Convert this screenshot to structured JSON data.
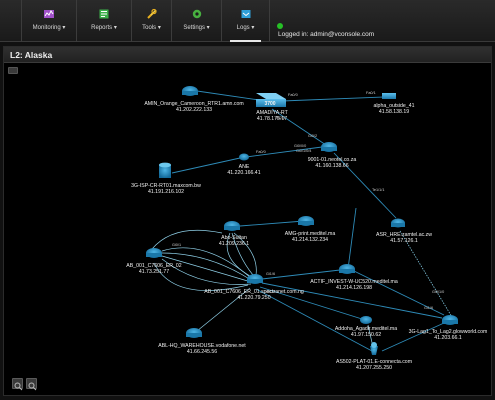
{
  "nav": {
    "items": [
      {
        "label": "Monitoring",
        "icon": "monitoring-icon"
      },
      {
        "label": "Reports",
        "icon": "reports-icon"
      },
      {
        "label": "Tools",
        "icon": "tools-icon"
      },
      {
        "label": "Settings",
        "icon": "settings-icon"
      },
      {
        "label": "Logs",
        "icon": "logs-icon"
      }
    ],
    "login_text": "Logged in: admin@vconsole.com"
  },
  "panel": {
    "title": "L2: Alaska"
  },
  "map": {
    "nodes": {
      "amin_orange": {
        "name": "AMIN_Orange_Cameroon_RTR1.amn.com",
        "ip": "41.202.222.133"
      },
      "amadiya": {
        "name": "AMADIYA-RT",
        "ip": "41.78.175.17",
        "badge": "3700"
      },
      "alpha_outside": {
        "name": "alpha_outside_41",
        "ip": "41.58.138.19"
      },
      "isp_cr": {
        "name": "3G-ISP-CR-RT01.maxcom.bw",
        "ip": "41.191.216.102"
      },
      "ane": {
        "name": "ANE",
        "ip": "41.220.166.41"
      },
      "hub9001": {
        "name": "9001-01.neotel.co.za",
        "ip": "41.160.138.66"
      },
      "abo_sultan": {
        "name": "Abo-Sultan",
        "ip": "41.209.236.1"
      },
      "amg_print": {
        "name": "AMG-print.meditel.ma",
        "ip": "41.214.132.234"
      },
      "asr_hre": {
        "name": "ASR_HRE.zamtel.ac.zw",
        "ip": "41.57.126.1"
      },
      "ab001": {
        "name": "AB_001_C7606_ER_02",
        "ip": "41.73.251.77"
      },
      "ab001_er01": {
        "name": "AB_001_C7606_ER_01.spectranet.com.ng",
        "ip": "41.220.79.250"
      },
      "actif": {
        "name": "ACTIF_INVEST-W-UC520.meditel.ma",
        "ip": "41.214.126.198"
      },
      "lag": {
        "name": "3G-Lag1_To_Lag2.glowworld.com",
        "ip": "41.203.66.1"
      },
      "abl_hq": {
        "name": "ABL-HQ_WAREHOUSE.vodafone.net",
        "ip": "41.66.245.56"
      },
      "addoha": {
        "name": "Addoha_Agadir.meditel.ma",
        "ip": "41.97.150.62"
      },
      "as5x": {
        "name": "AS502-PLAT-01.E-connecta.com",
        "ip": "41.207.255.250"
      }
    },
    "link_labels": {
      "amadiya_alpha": "Fa0/0",
      "amadiya_alpha_far": "Fa0/1",
      "amadiya_hub_a": "Gi2/1",
      "amadiya_hub_b": "Gi0/2",
      "ane_hub_a": "Fa0/0",
      "ane_hub_b": "Gi0/0/0",
      "ane_hub_c": "Gi0/1/0/4",
      "hub_asr": "Te1/1/1",
      "ab001_er01": "Gi0/1",
      "er01_actif": "Gi1/6",
      "er01_lag": "Gi1/6",
      "lag_asr": "Gi0/1/0",
      "er01_addoha": "Gi1/2"
    }
  }
}
